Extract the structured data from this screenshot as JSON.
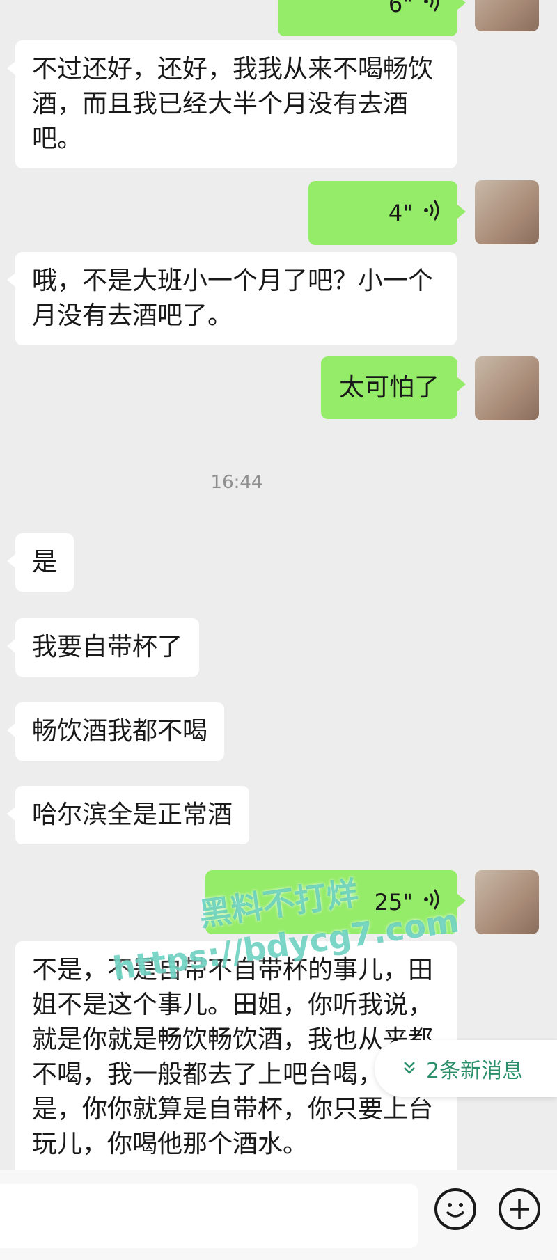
{
  "messages": {
    "voice_top": {
      "duration": "6\""
    },
    "msg1": {
      "text": "不过还好，还好，我我从来不喝畅饮酒，而且我已经大半个月没有去酒吧。"
    },
    "voice1": {
      "duration": "4\""
    },
    "msg2": {
      "text": "哦，不是大班小一个月了吧？小一个月没有去酒吧了。"
    },
    "msg3": {
      "text": "太可怕了"
    },
    "time": "16:44",
    "msg4": {
      "text": "是"
    },
    "msg5": {
      "text": "我要自带杯了"
    },
    "msg6": {
      "text": "畅饮酒我都不喝"
    },
    "msg7": {
      "text": "哈尔滨全是正常酒"
    },
    "voice2": {
      "duration": "25\""
    },
    "msg8": {
      "text": "不是，不是自带不自带杯的事儿，田姐不是这个事儿。田姐，你听我说，就是你就是畅饮畅饮酒，我也从来都不喝，我一般都去了上吧台喝，但是，你你就算是自带杯，你只要上台玩儿，你喝他那个酒水。"
    }
  },
  "new_messages_label": "2条新消息",
  "watermark": {
    "line1": "黑料不打烊",
    "line2": "https://bdycg7.com"
  },
  "icons": {
    "voice": "voice-wave-icon",
    "emoji": "emoji-icon",
    "plus": "plus-icon",
    "chevron": "double-chevron-down-icon"
  },
  "colors": {
    "own_bubble": "#95ec69",
    "other_bubble": "#ffffff",
    "background": "#ededed"
  }
}
